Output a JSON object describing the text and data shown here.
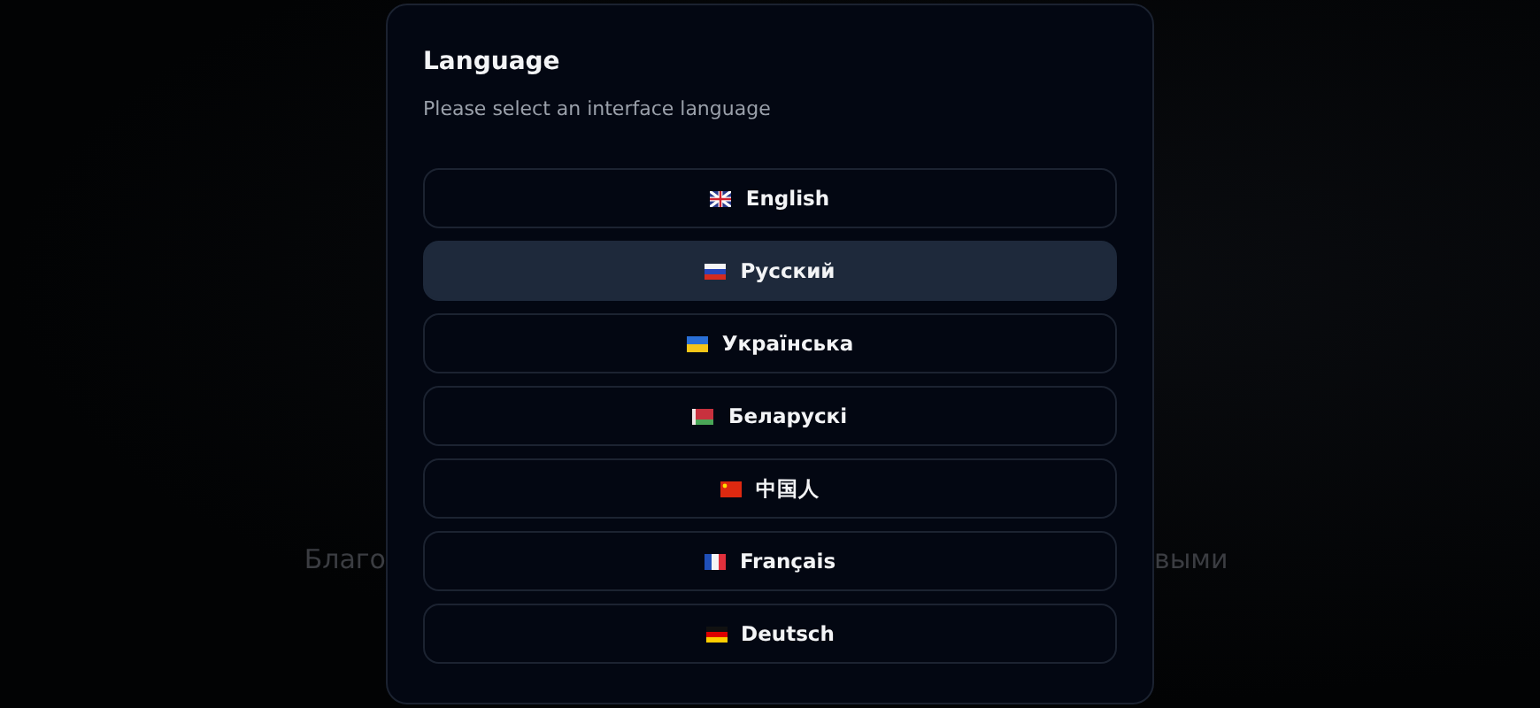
{
  "background": {
    "text_left": "Благо",
    "text_right": "выми"
  },
  "dialog": {
    "title": "Language",
    "subtitle": "Please select an interface language",
    "languages": [
      {
        "label": "English",
        "kind": "gb",
        "selected": false
      },
      {
        "label": "Русский",
        "kind": "ru",
        "selected": true
      },
      {
        "label": "Українська",
        "kind": "ua",
        "selected": false
      },
      {
        "label": "Беларускі",
        "kind": "by",
        "selected": false
      },
      {
        "label": "中国人",
        "kind": "cn",
        "selected": false
      },
      {
        "label": "Français",
        "kind": "fr",
        "selected": false
      },
      {
        "label": "Deutsch",
        "kind": "de",
        "selected": false
      }
    ]
  }
}
